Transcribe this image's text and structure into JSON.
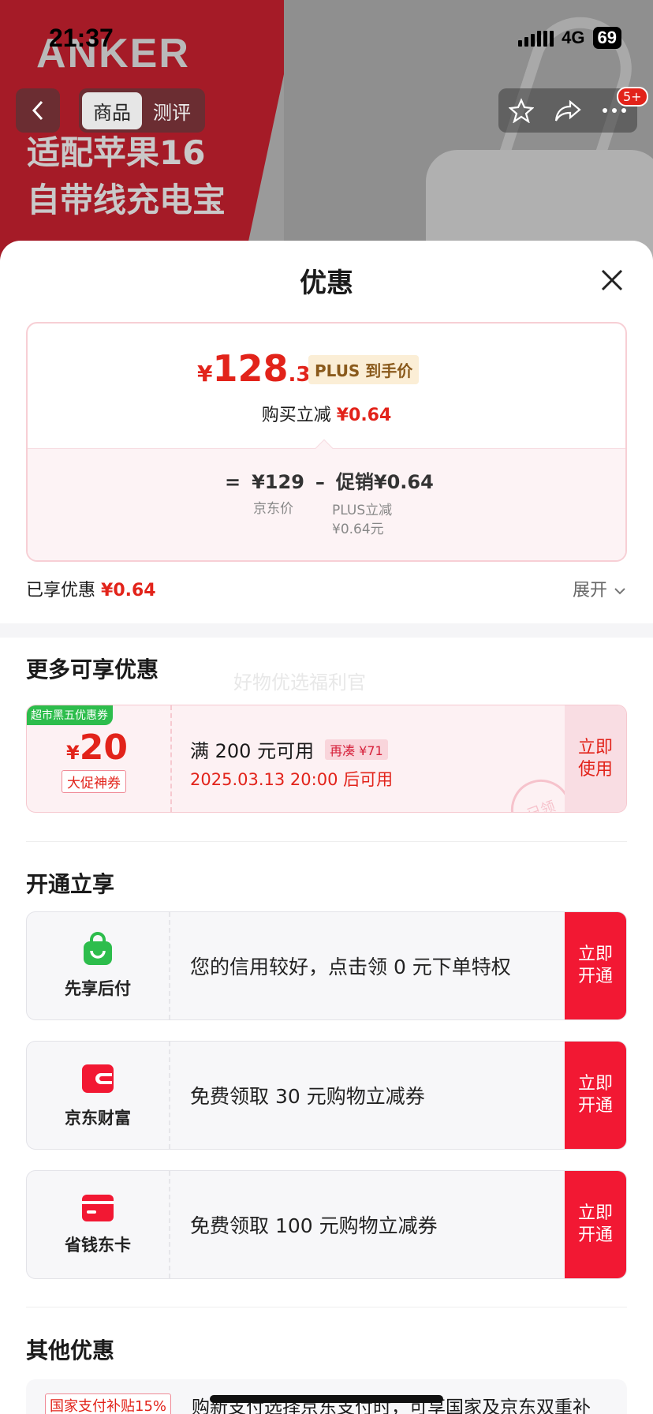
{
  "status_bar": {
    "time": "21:37",
    "network": "4G",
    "battery": "69"
  },
  "hero": {
    "brand": "ANKER",
    "line1": "适配苹果16",
    "line2": "自带线充电宝"
  },
  "nav": {
    "back": "‹",
    "tabs": [
      "商品",
      "测评"
    ],
    "badge": "5+"
  },
  "sheet": {
    "title": "优惠",
    "price": {
      "yen": "¥",
      "integer": "128",
      "decimal": ".36",
      "plus_tag": "PLUS 到手价",
      "instant_label": "购买立减",
      "instant_value": "¥0.64",
      "formula": {
        "eq": "=",
        "base": "¥129",
        "minus": "–",
        "promo": "促销¥0.64",
        "base_label": "京东价",
        "promo_label_1": "PLUS立减",
        "promo_label_2": "¥0.64元"
      }
    },
    "enjoyed_label": "已享优惠",
    "enjoyed_value": "¥0.64",
    "expand_label": "展开"
  },
  "more_section": {
    "title": "更多可享优惠",
    "watermark": "好物优选福利官",
    "coupon": {
      "tag": "超市黑五优惠券",
      "yen": "¥",
      "amount": "20",
      "sub": "大促神券",
      "condition": "满 200 元可用",
      "extra": "再凑 ¥71",
      "date": "2025.03.13 20:00 后可用",
      "button_line1": "立即",
      "button_line2": "使用",
      "stamp": "已领"
    }
  },
  "open_section": {
    "title": "开通立享",
    "cards": [
      {
        "icon": "bag-icon",
        "name": "先享后付",
        "text": "您的信用较好，点击领 0 元下单特权",
        "btn1": "立即",
        "btn2": "开通",
        "color": "#2dbd4c"
      },
      {
        "icon": "wallet-icon",
        "name": "京东财富",
        "text": "免费领取 30 元购物立减券",
        "btn1": "立即",
        "btn2": "开通",
        "color": "#f21833"
      },
      {
        "icon": "card-icon",
        "name": "省钱东卡",
        "text": "免费领取 100 元购物立减券",
        "btn1": "立即",
        "btn2": "开通",
        "color": "#f21833"
      }
    ]
  },
  "other_section": {
    "title": "其他优惠",
    "tag": "国家支付补贴15%",
    "text": "购新支付选择京东支付时，可享国家及京东双重补"
  },
  "colors": {
    "accent": "#e2231a",
    "button": "#f21833",
    "green": "#2dbd4c"
  }
}
